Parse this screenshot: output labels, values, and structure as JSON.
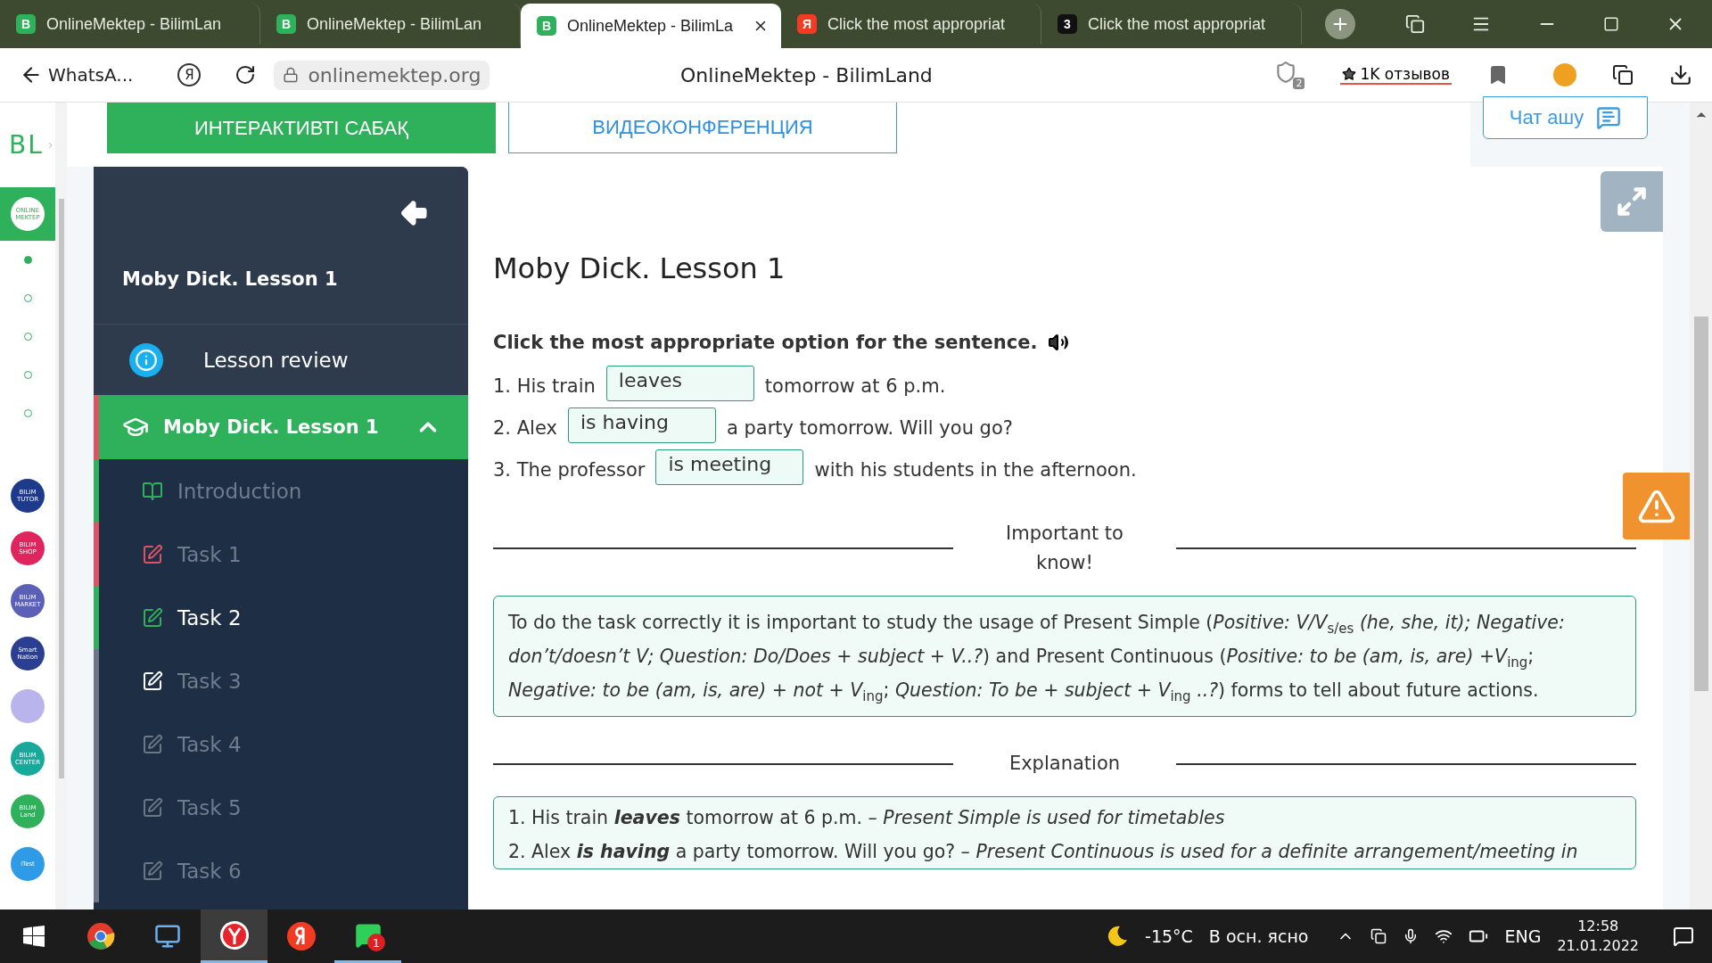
{
  "browser": {
    "tabs": [
      {
        "favicon": "B",
        "color": "#2fb05a",
        "title": "OnlineMektep - BilimLan",
        "selected": false,
        "closable": false
      },
      {
        "favicon": "B",
        "color": "#2fb05a",
        "title": "OnlineMektep - BilimLan",
        "selected": false,
        "closable": false
      },
      {
        "favicon": "B",
        "color": "#2fb05a",
        "title": "OnlineMektep - BilimLa",
        "selected": true,
        "closable": true
      },
      {
        "favicon": "Я",
        "color": "#f33a22",
        "title": "Click the most appropriat",
        "selected": false,
        "closable": false
      },
      {
        "favicon": "3",
        "color": "#111111",
        "title": "Click the most appropriat",
        "selected": false,
        "closable": false
      }
    ],
    "back_label": "WhatsA...",
    "yandex_glyph": "Я",
    "url": "onlinemektep.org",
    "page_title": "OnlineMektep - BilimLand",
    "shield_count": "2",
    "reviews": "1K отзывов"
  },
  "rail": {
    "logo": "BL",
    "home_app": [
      "ONLINE",
      "MEKTEP"
    ],
    "dots": [
      {
        "selected": true
      },
      {
        "selected": false
      },
      {
        "selected": false
      },
      {
        "selected": false
      },
      {
        "selected": false
      }
    ],
    "apps": [
      {
        "lines": [
          "BILIM",
          "TUTOR"
        ],
        "color": "#1e3a8a"
      },
      {
        "lines": [
          "BILIM",
          "SHOP"
        ],
        "color": "#e0245e"
      },
      {
        "lines": [
          "BILIM",
          "MARKET"
        ],
        "color": "#5b5fb5"
      },
      {
        "lines": [
          "Smart",
          "Nation"
        ],
        "color": "#2a3f8f"
      },
      {
        "color": "#b9b4ec"
      },
      {
        "lines": [
          "BILIM",
          "CENTER"
        ],
        "color": "#17a99a"
      },
      {
        "lines": [
          "BILIM",
          "Land"
        ],
        "color": "#2fb05a"
      },
      {
        "lines": [
          "iTest"
        ],
        "color": "#2f9be6"
      }
    ]
  },
  "top_tabs": [
    {
      "label": "ИНТЕРАКТИВТІ САБАҚ",
      "selected": true
    },
    {
      "label": "ВИДЕОКОНФЕРЕНЦИЯ",
      "selected": false
    }
  ],
  "chat_button": "Чат ашу",
  "sidebar": {
    "title": "Moby Dick. Lesson 1",
    "review": "Lesson review",
    "section": {
      "title": "Moby Dick. Lesson 1",
      "expanded": true,
      "items": [
        {
          "kind": "intro",
          "label": "Introduction",
          "color": "#2fb05a",
          "selected": false
        },
        {
          "kind": "task",
          "label": "Task 1",
          "color": "#e05263",
          "selected": false
        },
        {
          "kind": "task",
          "label": "Task 2",
          "color": "#2fb05a",
          "selected": true
        },
        {
          "kind": "task",
          "label": "Task 3",
          "color": "#ffffff",
          "selected": false
        },
        {
          "kind": "task",
          "label": "Task 4",
          "color": "#6b7785",
          "selected": false
        },
        {
          "kind": "task",
          "label": "Task 5",
          "color": "#6b7785",
          "selected": false
        },
        {
          "kind": "task",
          "label": "Task 6",
          "color": "#6b7785",
          "selected": false
        }
      ]
    }
  },
  "lesson": {
    "title": "Moby Dick. Lesson 1",
    "instruction": "Click the most appropriate option for the sentence.",
    "sentences": [
      {
        "before": "1. His train",
        "answer": "leaves",
        "after": "tomorrow at 6 p.m."
      },
      {
        "before": "2. Alex",
        "answer": "is having",
        "after": "a party tomorrow. Will you go?"
      },
      {
        "before": "3. The professor",
        "answer": "is meeting",
        "after": "with his students in the afternoon."
      }
    ],
    "important_heading": "Important to know!",
    "important_text": "To do the task correctly it is important to study the usage of Present Simple (*Positive: V/V*$_{s/es}$ *(he, she, it); Negative: don’t/doesn’t V; Question: Do/Does + subject + V..?*) and Present Continuous (*Positive: to be (am, is, are) +V*$_{ing}$; *Negative: to be (am, is, are) + not + V*$_{ing}$; *Question: To be + subject + V*$_{ing}$ *..?*) forms to tell about future actions.",
    "explanation_heading": "Explanation",
    "explanations": [
      "1. His train **leaves** tomorrow at 6 p.m. – *Present Simple is used for timetables*",
      "2. Alex **is having** a party tomorrow. Will you go? – *Present Continuous is used for a definite arrangement/meeting in*"
    ]
  },
  "taskbar": {
    "whatsapp_badge": "1",
    "temperature": "-15°C",
    "weather": "В осн. ясно",
    "language": "ENG",
    "time": "12:58",
    "date": "21.01.2022"
  }
}
